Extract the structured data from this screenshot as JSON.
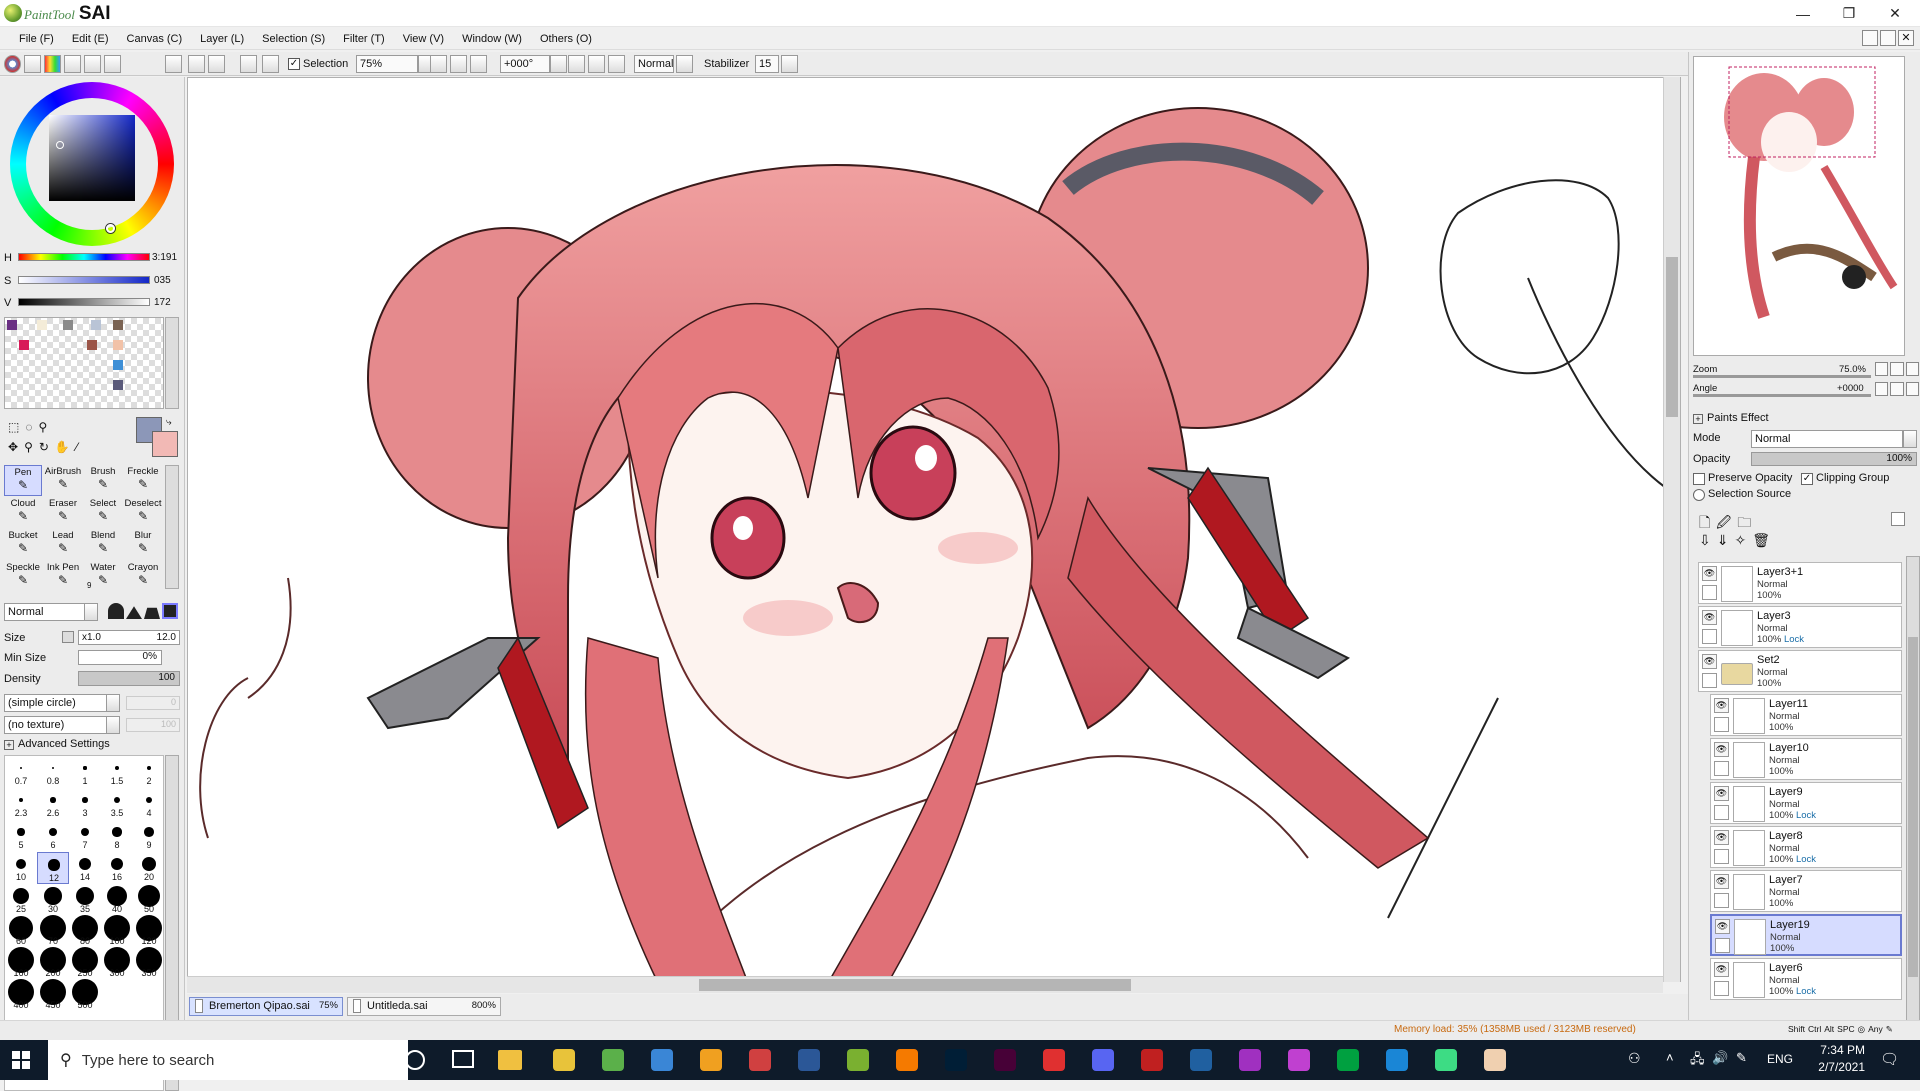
{
  "app": {
    "brand": "PaintTool",
    "name": "SAI"
  },
  "window_controls": {
    "minimize": "—",
    "restore": "❐",
    "close": "✕"
  },
  "menu": [
    "File (F)",
    "Edit (E)",
    "Canvas (C)",
    "Layer (L)",
    "Selection (S)",
    "Filter (T)",
    "View (V)",
    "Window (W)",
    "Others (O)"
  ],
  "toolbar": {
    "selection_label": "Selection",
    "selection_checked": true,
    "zoom": "75%",
    "angle": "+000°",
    "blend": "Normal",
    "stabilizer_label": "Stabilizer",
    "stabilizer_value": "15"
  },
  "color": {
    "h_label": "H",
    "h_value": "3:191",
    "s_label": "S",
    "s_value": "035",
    "v_label": "V",
    "v_value": "172",
    "primary": "#8c97b8",
    "secondary": "#f2b9b5",
    "swatches": [
      "#6a2f83",
      "#f4ecd8",
      "#8a8a8a",
      "#b9c4d6",
      "#7a6353",
      "#d81a58",
      "#f2c2a8",
      "#9b5548",
      "#3e8fd6",
      "#5a5a7a"
    ]
  },
  "tools": {
    "rows": [
      [
        "Pen",
        "AirBrush",
        "Brush",
        "Freckle"
      ],
      [
        "Cloud",
        "Eraser",
        "Select",
        "Deselect"
      ],
      [
        "Bucket",
        "Lead",
        "Blend",
        "Blur"
      ],
      [
        "Speckle",
        "Ink Pen",
        "Water",
        "Crayon"
      ]
    ],
    "active": "Pen",
    "water_sub": "9"
  },
  "brush": {
    "mode": "Normal",
    "size_label": "Size",
    "size_mult": "x1.0",
    "size_value": "12.0",
    "minsize_label": "Min Size",
    "minsize_value": "0%",
    "density_label": "Density",
    "density_value": "100",
    "shape": "(simple circle)",
    "shape_value": "0",
    "texture": "(no texture)",
    "texture_value": "100",
    "advanced": "Advanced Settings",
    "sizes": [
      "0.7",
      "0.8",
      "1",
      "1.5",
      "2",
      "2.3",
      "2.6",
      "3",
      "3.5",
      "4",
      "5",
      "6",
      "7",
      "8",
      "9",
      "10",
      "12",
      "14",
      "16",
      "20",
      "25",
      "30",
      "35",
      "40",
      "50",
      "60",
      "70",
      "80",
      "100",
      "120",
      "160",
      "200",
      "250",
      "300",
      "350",
      "400",
      "450",
      "500"
    ],
    "selected_size": "12"
  },
  "navigator": {
    "zoom_label": "Zoom",
    "zoom_value": "75.0%",
    "angle_label": "Angle",
    "angle_value": "+0000"
  },
  "layer_props": {
    "paints_effect": "Paints Effect",
    "mode_label": "Mode",
    "mode_value": "Normal",
    "opacity_label": "Opacity",
    "opacity_value": "100%",
    "preserve_opacity": "Preserve Opacity",
    "clipping_group": "Clipping Group",
    "clipping_checked": true,
    "selection_source": "Selection Source"
  },
  "layers": [
    {
      "name": "Layer3+1",
      "mode": "Normal",
      "opacity": "100%",
      "lock": ""
    },
    {
      "name": "Layer3",
      "mode": "Normal",
      "opacity": "100%",
      "lock": "Lock"
    },
    {
      "name": "Set2",
      "mode": "Normal",
      "opacity": "100%",
      "lock": "",
      "folder": true
    },
    {
      "name": "Layer11",
      "mode": "Normal",
      "opacity": "100%",
      "lock": ""
    },
    {
      "name": "Layer10",
      "mode": "Normal",
      "opacity": "100%",
      "lock": ""
    },
    {
      "name": "Layer9",
      "mode": "Normal",
      "opacity": "100%",
      "lock": "Lock"
    },
    {
      "name": "Layer8",
      "mode": "Normal",
      "opacity": "100%",
      "lock": "Lock"
    },
    {
      "name": "Layer7",
      "mode": "Normal",
      "opacity": "100%",
      "lock": ""
    },
    {
      "name": "Layer19",
      "mode": "Normal",
      "opacity": "100%",
      "lock": "",
      "selected": true
    },
    {
      "name": "Layer6",
      "mode": "Normal",
      "opacity": "100%",
      "lock": "Lock"
    }
  ],
  "tabs": [
    {
      "name": "Bremerton Qipao.sai",
      "zoom": "75%",
      "active": true
    },
    {
      "name": "Untitleda.sai",
      "zoom": "800%",
      "active": false
    }
  ],
  "status": {
    "memory": "Memory load: 35% (1358MB used / 3123MB reserved)",
    "keys": [
      "Shift",
      "Ctrl",
      "Alt",
      "SPC"
    ],
    "any": "Any"
  },
  "taskbar": {
    "search_placeholder": "Type here to search",
    "lang": "ENG",
    "time": "7:34 PM",
    "date": "2/7/2021",
    "apps": [
      "chrome-icon",
      "refresh-icon",
      "edge-icon",
      "blender-icon",
      "grid-icon",
      "word-icon",
      "sai-icon",
      "illustrator-icon",
      "photoshop-icon",
      "indesign-icon",
      "speedo-icon",
      "discord-icon",
      "game-icon",
      "window-icon",
      "hex-icon",
      "hex2-icon",
      "drive-icon",
      "teamviewer-icon",
      "android-icon",
      "avatar-icon"
    ]
  }
}
